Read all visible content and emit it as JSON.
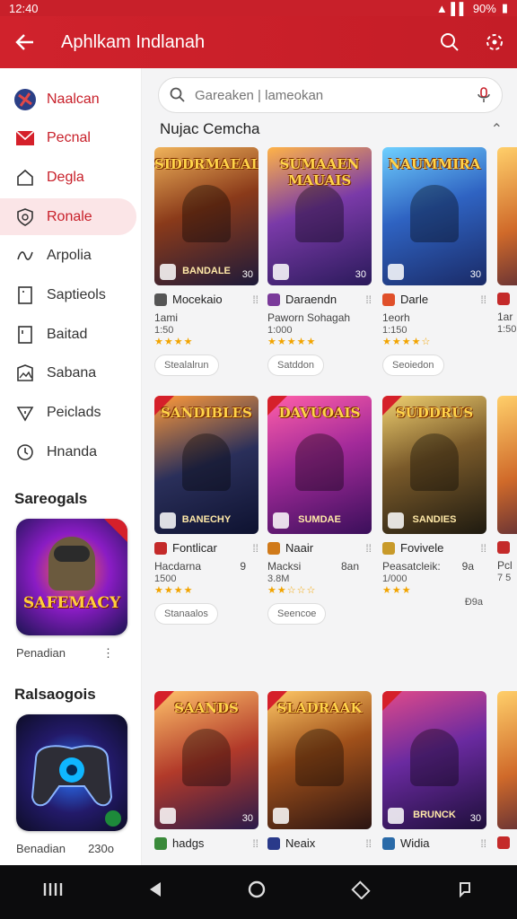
{
  "status": {
    "time": "12:40",
    "battery": "90%"
  },
  "appbar": {
    "title": "Aphlkam Indlanah"
  },
  "sidebar": {
    "items": [
      {
        "label": "Naalcan",
        "icon": "globe-icon"
      },
      {
        "label": "Pecnal",
        "icon": "mail-icon"
      },
      {
        "label": "Degla",
        "icon": "home-icon"
      },
      {
        "label": "Ronale",
        "icon": "shield-icon"
      },
      {
        "label": "Arpolia",
        "icon": "wave-icon"
      },
      {
        "label": "Saptieols",
        "icon": "document-icon"
      },
      {
        "label": "Baitad",
        "icon": "file-icon"
      },
      {
        "label": "Sabana",
        "icon": "image-icon"
      },
      {
        "label": "Peiclads",
        "icon": "heart-icon"
      },
      {
        "label": "Hnanda",
        "icon": "clock-icon"
      }
    ],
    "section1": {
      "heading": "Sareogals",
      "card_title": "SAFEMACY",
      "caption": "Penadian"
    },
    "section2": {
      "heading": "Ralsaogois",
      "caption": "Benadian",
      "count": "230o"
    }
  },
  "search": {
    "placeholder": "Gareaken | lameokan"
  },
  "section": {
    "title": "Nujac Cemcha"
  },
  "games": [
    {
      "art_title": "SIDDRMAEALK",
      "art_bottom": "BANDALE",
      "badge": "30",
      "name": "Mocekaio",
      "line2": "1ami",
      "line3": "1:50",
      "stars": "★★★★",
      "button": "Stealalrun"
    },
    {
      "art_title": "SUMAAEN MAUAIS",
      "art_bottom": "",
      "badge": "30",
      "name": "Daraendn",
      "line2": "Paworn Sohagah",
      "line3": "1:000",
      "stars": "★★★★★",
      "button": "Satddon"
    },
    {
      "art_title": "NAUMMIRA",
      "art_bottom": "",
      "badge": "30",
      "name": "Darle",
      "line2": "1eorh",
      "line3": "1:150",
      "stars": "★★★★☆",
      "button": "Seoiedon"
    },
    {
      "art_title": "SANDIBLES",
      "art_bottom": "BANECHY",
      "badge": "",
      "name": "Fontlicar",
      "line2": "Hacdarna",
      "line2b": "9",
      "line3": "1500",
      "stars": "★★★★",
      "button": "Stanaalos"
    },
    {
      "art_title": "DAVUOAIS",
      "art_bottom": "SUMDAE",
      "badge": "",
      "name": "Naair",
      "line2": "Macksi",
      "line2b": "8an",
      "line3": "3.8M",
      "stars": "★★☆☆☆",
      "button": "Seencoe"
    },
    {
      "art_title": "SUDDRUS",
      "art_bottom": "SANDIES",
      "badge": "",
      "name": "Fovivele",
      "line2": "Peasatcleik:",
      "line2b": "9a",
      "line3": "1/000",
      "stars": "★★★",
      "button": "",
      "extra": "Đ9a"
    },
    {
      "art_title": "SAANDS",
      "art_bottom": "",
      "badge": "30",
      "name": "hadgs",
      "line2": "",
      "line3": "",
      "stars": "",
      "button": ""
    },
    {
      "art_title": "SLADRAAK",
      "art_bottom": "",
      "badge": "",
      "name": "Neaix",
      "line2": "",
      "line3": "",
      "stars": "",
      "button": ""
    },
    {
      "art_title": "",
      "art_bottom": "BRUNCK",
      "badge": "30",
      "name": "Widia",
      "line2": "",
      "line3": "",
      "stars": "",
      "button": ""
    }
  ],
  "edge": [
    {
      "line2": "1ar",
      "line3": "1:50"
    },
    {
      "line2": "Pcl",
      "line3": "7 5"
    },
    {
      "line2": "",
      "line3": ""
    }
  ],
  "colors": {
    "brand": "#c8202a"
  }
}
